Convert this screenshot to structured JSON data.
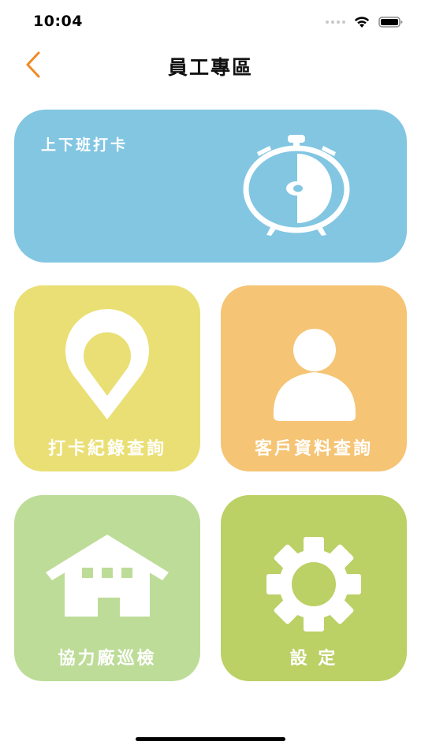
{
  "status_bar": {
    "time": "10:04"
  },
  "nav": {
    "title": "員工專區",
    "back_icon": "chevron-left-icon"
  },
  "tiles": {
    "clock": {
      "label": "上下班打卡",
      "icon": "alarm-clock-icon",
      "color": "#82C6E2"
    },
    "records": {
      "label": "打卡紀錄查詢",
      "icon": "map-pin-icon",
      "color": "#EADF74"
    },
    "customers": {
      "label": "客戶資料查詢",
      "icon": "person-icon",
      "color": "#F5C475"
    },
    "factory": {
      "label": "協力廠巡檢",
      "icon": "house-icon",
      "color": "#BDDC98"
    },
    "settings": {
      "label": "設 定",
      "icon": "gear-icon",
      "color": "#BBD065"
    }
  },
  "colors": {
    "accent": "#F08A24",
    "text_primary": "#111111",
    "tile_text": "#FFFFFF"
  }
}
